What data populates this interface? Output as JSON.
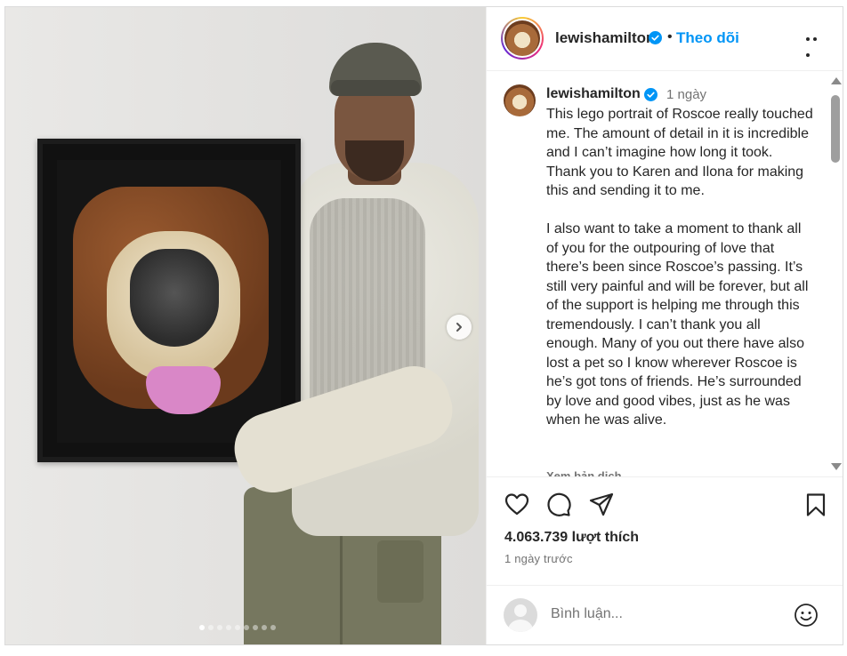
{
  "post": {
    "username": "lewishamilton",
    "follow_separator": "•",
    "follow_label": "Theo dõi",
    "time_short": "1 ngày",
    "caption": "This lego portrait of Roscoe really touched me. The amount of detail in it is incredible and I can’t imagine how long it took. Thank you to Karen and Ilona for making this and sending it to me.\n\nI also want to take a moment to thank all of you for the outpouring of love that there’s been since Roscoe’s passing. It’s still very painful and will be forever, but all of the support is helping me through this tremendously. I can’t thank you all enough. Many of you out there have also lost a pet so I know wherever Roscoe is he’s got tons of friends. He’s surrounded by love and good vibes, just as he was when he was alive.",
    "translate_label": "Xem bản dịch",
    "likes": "4.063.739 lượt thích",
    "time_ago": "1 ngày trước"
  },
  "comment": {
    "placeholder": "Bình luận..."
  },
  "carousel": {
    "total": 9,
    "active_index": 0
  },
  "icons": {
    "like": "heart-icon",
    "comment": "comment-icon",
    "share": "send-icon",
    "save": "bookmark-icon",
    "more": "more-horizontal-icon",
    "emoji": "emoji-icon",
    "verified": "verified-badge-icon",
    "next": "chevron-right-icon"
  },
  "colors": {
    "follow_blue": "#0095f6",
    "verified_blue": "#0095f6",
    "text_primary": "#262626",
    "text_secondary": "#737373",
    "border": "#dbdbdb"
  }
}
